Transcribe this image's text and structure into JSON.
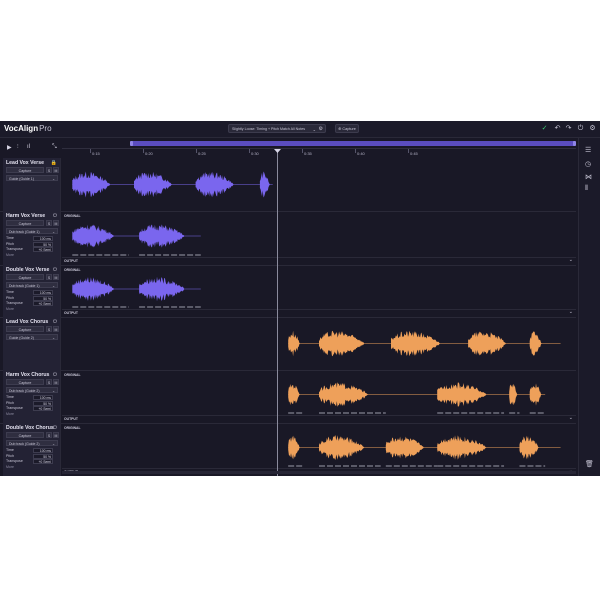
{
  "app": {
    "name": "VocAlign",
    "edition": "Pro"
  },
  "header": {
    "preset_label": "Slightly Loose: Timing + Pitch Match All Notes",
    "capture_label": "⊕ Capture"
  },
  "colors": {
    "guide_verse": "#7a66ee",
    "guide_chorus": "#eea05a",
    "bg": "#191826"
  },
  "timeline": {
    "labels": [
      "0:15",
      "0:20",
      "0:25",
      "0:30",
      "0:35",
      "0:40",
      "0:45"
    ]
  },
  "labels": {
    "original": "ORIGINAL",
    "output": "OUTPUT",
    "capture": "Capture",
    "solo": "S",
    "mute": "M",
    "time": "Time",
    "pitch": "Pitch",
    "transpose": "Transpose",
    "more": "More"
  },
  "tracks": [
    {
      "name": "Lead Vox Verse",
      "role": "guide",
      "color": "#7a66ee",
      "selector": "Guide (Guide 1)",
      "icon": "lock-icon"
    },
    {
      "name": "Harm Vox Verse",
      "role": "dub",
      "color": "#7a66ee",
      "selector": "Dub track (Guide 1)",
      "time": "100 ms",
      "pitch": "50 %",
      "transpose": "+0 Semi",
      "icon": "power-icon"
    },
    {
      "name": "Double Vox Verse",
      "role": "dub",
      "color": "#7a66ee",
      "selector": "Dub track (Guide 1)",
      "time": "100 ms",
      "pitch": "50 %",
      "transpose": "+0 Semi",
      "icon": "power-icon"
    },
    {
      "name": "Lead Vox Chorus",
      "role": "guide",
      "color": "#eea05a",
      "selector": "Guide (Guide 2)",
      "icon": "power-icon"
    },
    {
      "name": "Harm Vox Chorus",
      "role": "dub",
      "color": "#eea05a",
      "selector": "Dub track (Guide 2)",
      "time": "100 ms",
      "pitch": "50 %",
      "transpose": "+0 Semi",
      "icon": "power-icon"
    },
    {
      "name": "Double Vox Chorus",
      "role": "dub",
      "color": "#eea05a",
      "selector": "Dub track (Guide 2)",
      "time": "100 ms",
      "pitch": "50 %",
      "transpose": "+0 Semi",
      "icon": "power-icon"
    }
  ],
  "waves": [
    {
      "color": "#7a66ee",
      "range": [
        0.02,
        0.41
      ],
      "segments": [
        [
          0.02,
          0.12
        ],
        [
          0.14,
          0.24
        ],
        [
          0.26,
          0.36
        ],
        [
          0.385,
          0.41
        ]
      ]
    },
    {
      "color": "#7a66ee",
      "range": [
        0.02,
        0.27
      ],
      "segments": [
        [
          0.02,
          0.13
        ],
        [
          0.15,
          0.27
        ]
      ]
    },
    {
      "color": "#7a66ee",
      "range": [
        0.02,
        0.27
      ],
      "segments": [
        [
          0.02,
          0.13
        ],
        [
          0.15,
          0.27
        ]
      ]
    },
    {
      "color": "#eea05a",
      "range": [
        0.44,
        0.97
      ],
      "segments": [
        [
          0.44,
          0.47
        ],
        [
          0.5,
          0.62
        ],
        [
          0.64,
          0.77
        ],
        [
          0.79,
          0.89
        ],
        [
          0.91,
          0.94
        ]
      ]
    },
    {
      "color": "#eea05a",
      "range": [
        0.44,
        0.94
      ],
      "segments": [
        [
          0.44,
          0.47
        ],
        [
          0.5,
          0.63
        ],
        [
          0.73,
          0.86
        ],
        [
          0.87,
          0.89
        ],
        [
          0.91,
          0.94
        ]
      ]
    },
    {
      "color": "#eea05a",
      "range": [
        0.44,
        0.97
      ],
      "segments": [
        [
          0.44,
          0.47
        ],
        [
          0.5,
          0.62
        ],
        [
          0.63,
          0.73
        ],
        [
          0.73,
          0.86
        ],
        [
          0.89,
          0.94
        ]
      ]
    }
  ]
}
